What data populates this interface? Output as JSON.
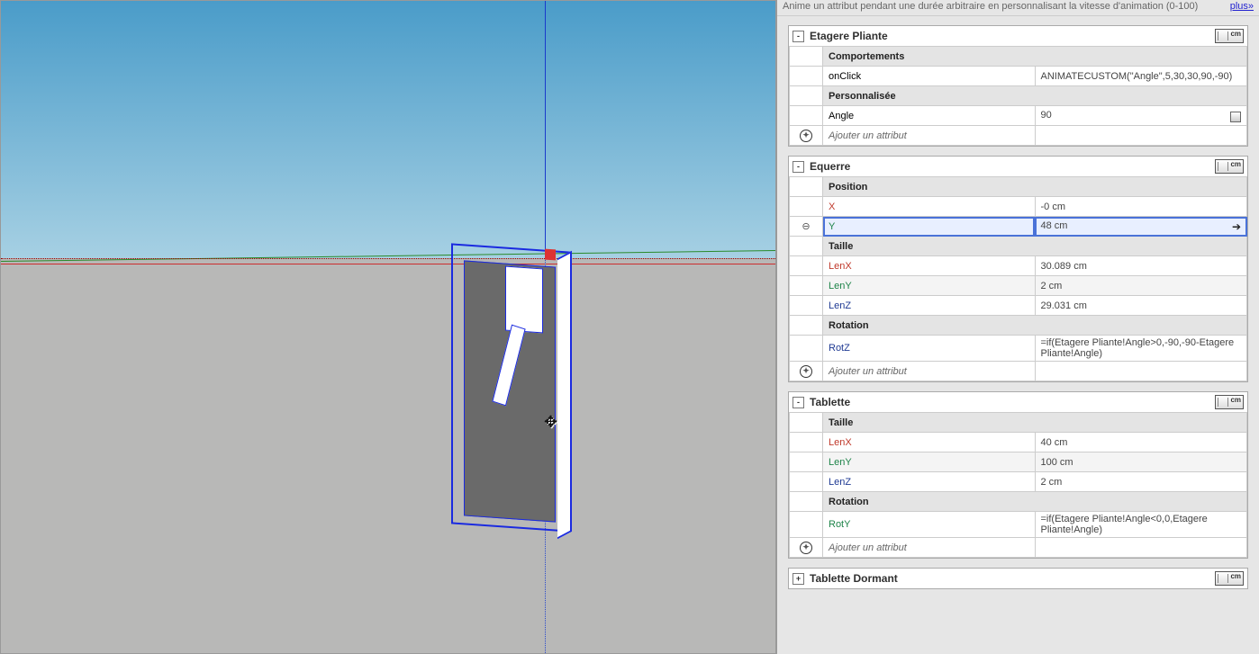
{
  "top_info": {
    "text": "Anime un attribut pendant une durée arbitraire en personnalisant la vitesse d'animation (0-100)",
    "link": "plus»"
  },
  "ruler_unit": "cm",
  "blocks": [
    {
      "title": "Etagere Pliante",
      "toggle": "-",
      "sections": [
        {
          "heading": "Comportements",
          "rows": [
            {
              "icon": "",
              "label": "onClick",
              "value": "ANIMATECUSTOM(\"Angle\",5,30,30,90,-90)"
            }
          ]
        },
        {
          "heading": "Personnalisée",
          "rows": [
            {
              "icon": "",
              "label": "Angle",
              "value": "90",
              "trail_icon": true
            }
          ]
        },
        {
          "add": true,
          "icon": "✦",
          "label": "Ajouter un attribut",
          "value": ""
        }
      ]
    },
    {
      "title": "Equerre",
      "toggle": "-",
      "sections": [
        {
          "heading": "Position",
          "rows": [
            {
              "icon": "",
              "label": "X",
              "cls": "attr-x",
              "value": "-0 cm"
            },
            {
              "icon": "⊖",
              "label": "Y",
              "cls": "attr-y",
              "value": "48 cm",
              "selected": true,
              "arrow": true
            }
          ]
        },
        {
          "heading": "Taille",
          "rows": [
            {
              "icon": "",
              "label": "LenX",
              "cls": "attr-x",
              "value": "30.089 cm"
            },
            {
              "icon": "",
              "label": "LenY",
              "cls": "attr-y",
              "value": "2 cm"
            },
            {
              "icon": "",
              "label": "LenZ",
              "cls": "attr-z",
              "value": "29.031 cm"
            }
          ]
        },
        {
          "heading": "Rotation",
          "rows": [
            {
              "icon": "",
              "label": "RotZ",
              "cls": "attr-rot",
              "value": "=if(Etagere Pliante!Angle>0,-90,-90-Etagere Pliante!Angle)"
            }
          ]
        },
        {
          "add": true,
          "icon": "✦",
          "label": "Ajouter un attribut",
          "value": ""
        }
      ]
    },
    {
      "title": "Tablette",
      "toggle": "-",
      "sections": [
        {
          "heading": "Taille",
          "rows": [
            {
              "icon": "",
              "label": "LenX",
              "cls": "attr-x",
              "value": "40 cm"
            },
            {
              "icon": "",
              "label": "LenY",
              "cls": "attr-y",
              "value": "100 cm"
            },
            {
              "icon": "",
              "label": "LenZ",
              "cls": "attr-z",
              "value": "2 cm"
            }
          ]
        },
        {
          "heading": "Rotation",
          "rows": [
            {
              "icon": "",
              "label": "RotY",
              "cls": "attr-y",
              "value": "=if(Etagere Pliante!Angle<0,0,Etagere Pliante!Angle)"
            }
          ]
        },
        {
          "add": true,
          "icon": "✦",
          "label": "Ajouter un attribut",
          "value": ""
        }
      ]
    },
    {
      "title": "Tablette Dormant",
      "toggle": "+",
      "sections": []
    }
  ]
}
